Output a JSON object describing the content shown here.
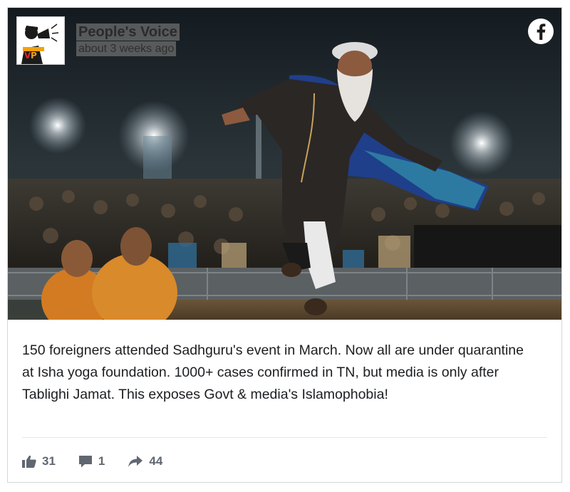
{
  "post": {
    "page_name": "People's Voice",
    "timestamp": "about 3 weeks ago",
    "avatar": {
      "text": "PEOPLE'S VOICE",
      "mono": "VP"
    },
    "text": "150 foreigners attended Sadhguru's event in March. Now all are under quarantine at Isha yoga foundation. 1000+ cases confirmed in TN, but media is only after Tablighi Jamat. This exposes Govt & media's Islamophobia!",
    "reactions": {
      "likes": "31",
      "comments": "1",
      "shares": "44"
    }
  },
  "icons": {
    "brand": "facebook-icon",
    "like": "thumbs-up-icon",
    "comment": "speech-bubble-icon",
    "share": "share-arrow-icon"
  },
  "colors": {
    "facebook_blue": "#ffffff",
    "text": "#1c1e21",
    "muted": "#606770",
    "avatar_orange": "#f2a20c"
  }
}
